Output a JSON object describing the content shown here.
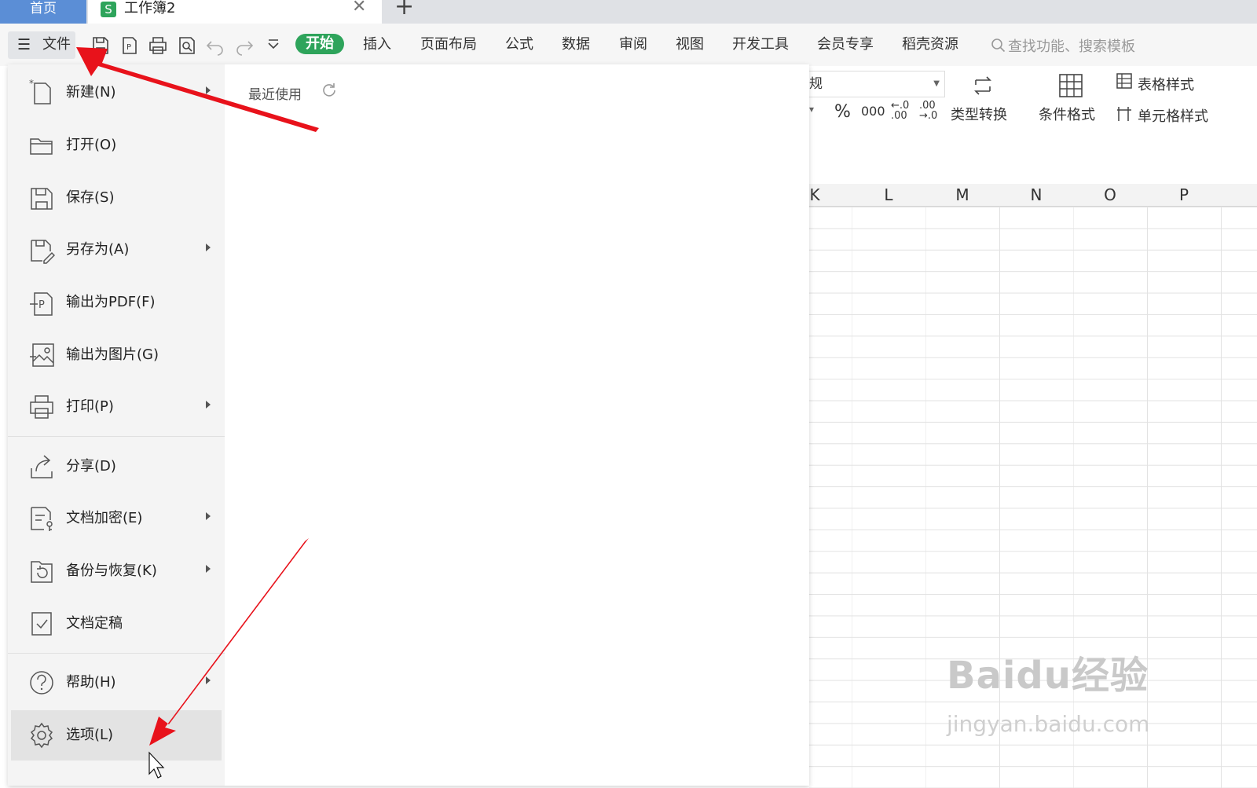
{
  "titlebar": {
    "home_tab": "首页",
    "doc_tab": "工作簿2",
    "doc_icon_letter": "S"
  },
  "toolbar": {
    "file_label": "文件",
    "tabs": [
      "开始",
      "插入",
      "页面布局",
      "公式",
      "数据",
      "审阅",
      "视图",
      "开发工具",
      "会员专享",
      "稻壳资源"
    ],
    "active_tab": "开始",
    "search_placeholder": "查找功能、搜索模板"
  },
  "ribbon": {
    "number_format_value": "规",
    "percent": "%",
    "thousands": "000",
    "inc_decimal": "←.0 .00",
    "dec_decimal": ".00 →.0",
    "type_convert": "类型转换",
    "conditional_format": "条件格式",
    "table_style": "表格样式",
    "cell_style": "单元格样式"
  },
  "sheet": {
    "columns": [
      "K",
      "L",
      "M",
      "N",
      "O",
      "P"
    ]
  },
  "file_menu": {
    "recent_label": "最近使用",
    "items": [
      {
        "label": "新建(N)",
        "icon": "new-file-icon",
        "submenu": true
      },
      {
        "label": "打开(O)",
        "icon": "folder-open-icon",
        "submenu": false
      },
      {
        "label": "保存(S)",
        "icon": "save-icon",
        "submenu": false
      },
      {
        "label": "另存为(A)",
        "icon": "save-as-icon",
        "submenu": true
      },
      {
        "label": "输出为PDF(F)",
        "icon": "export-pdf-icon",
        "submenu": false
      },
      {
        "label": "输出为图片(G)",
        "icon": "export-image-icon",
        "submenu": false
      },
      {
        "label": "打印(P)",
        "icon": "print-icon",
        "submenu": true
      },
      {
        "label": "分享(D)",
        "icon": "share-icon",
        "submenu": false
      },
      {
        "label": "文档加密(E)",
        "icon": "encrypt-icon",
        "submenu": true
      },
      {
        "label": "备份与恢复(K)",
        "icon": "backup-icon",
        "submenu": true
      },
      {
        "label": "文档定稿",
        "icon": "finalize-icon",
        "submenu": false
      },
      {
        "label": "帮助(H)",
        "icon": "help-icon",
        "submenu": true
      },
      {
        "label": "选项(L)",
        "icon": "gear-icon",
        "submenu": false
      }
    ],
    "selected_item": "选项(L)"
  },
  "watermark": {
    "logo_text": "Baidu经验",
    "url_text": "jingyan.baidu.com"
  },
  "colors": {
    "accent_green": "#2ea45b",
    "home_tab_blue": "#5b8ed6",
    "arrow_red": "#e8121b"
  }
}
